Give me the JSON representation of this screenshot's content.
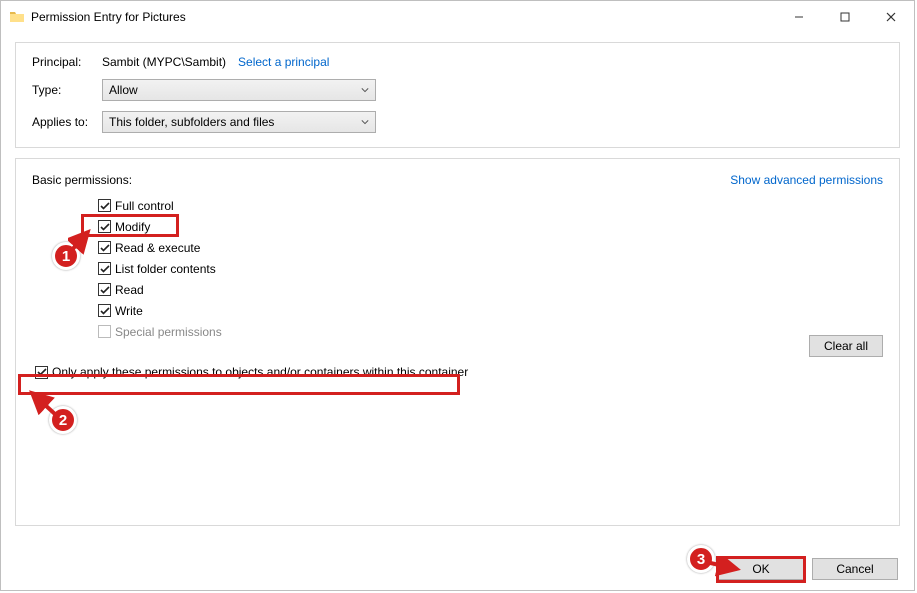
{
  "window": {
    "title": "Permission Entry for Pictures"
  },
  "header": {
    "principal_label": "Principal:",
    "principal_value": "Sambit (MYPC\\Sambit)",
    "select_principal": "Select a principal",
    "type_label": "Type:",
    "type_value": "Allow",
    "applies_label": "Applies to:",
    "applies_value": "This folder, subfolders and files"
  },
  "perms": {
    "title": "Basic permissions:",
    "advanced_link": "Show advanced permissions",
    "items": [
      {
        "label": "Full control",
        "checked": true
      },
      {
        "label": "Modify",
        "checked": true
      },
      {
        "label": "Read & execute",
        "checked": true
      },
      {
        "label": "List folder contents",
        "checked": true
      },
      {
        "label": "Read",
        "checked": true
      },
      {
        "label": "Write",
        "checked": true
      },
      {
        "label": "Special permissions",
        "checked": false,
        "disabled": true
      }
    ],
    "only_apply": "Only apply these permissions to objects and/or containers within this container",
    "only_checked": true,
    "clear_all": "Clear all"
  },
  "footer": {
    "ok": "OK",
    "cancel": "Cancel"
  },
  "annotations": {
    "b1": "1",
    "b2": "2",
    "b3": "3"
  }
}
